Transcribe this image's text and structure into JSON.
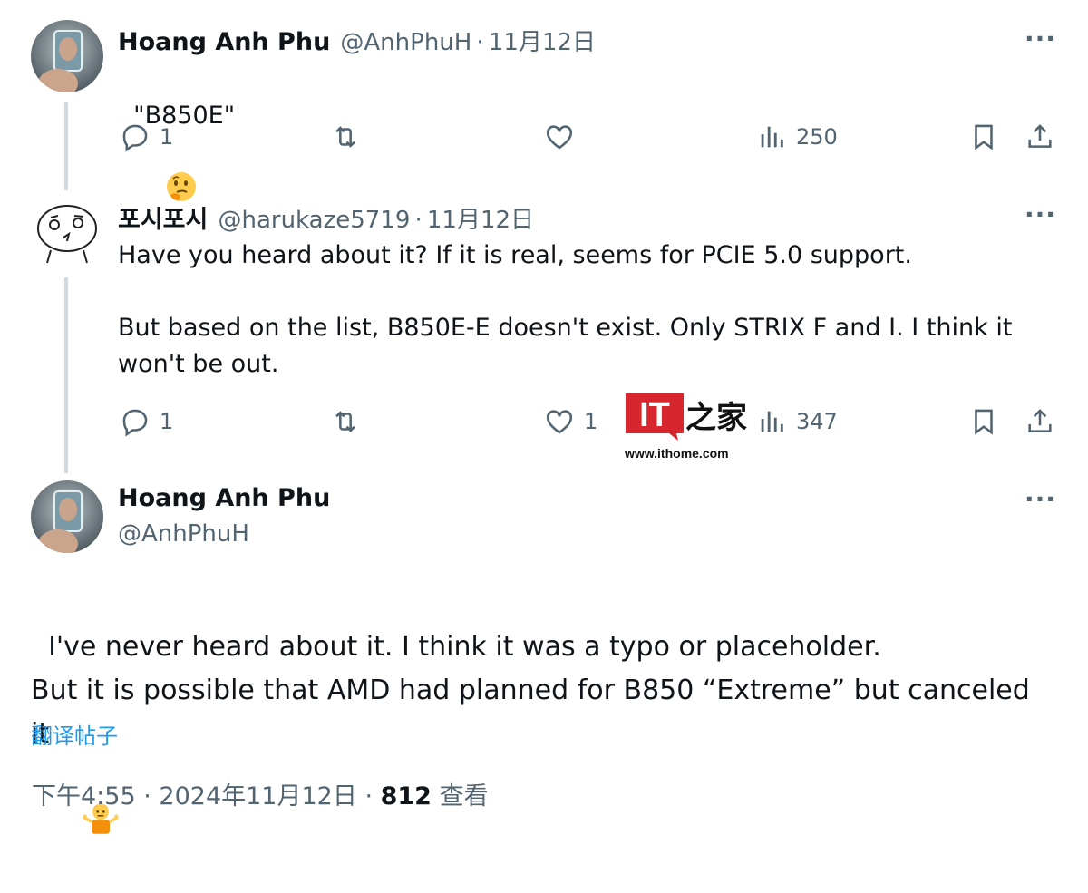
{
  "tweet1": {
    "name": "Hoang Anh Phu",
    "handle": "@AnhPhuH",
    "date": "11月12日",
    "text": "\"B850E\"",
    "emoji": "thinking-face",
    "more": "···",
    "actions": {
      "reply": "1",
      "retweet": "",
      "like": "",
      "views": "250"
    }
  },
  "tweet2": {
    "name": "포시포시",
    "handle": "@harukaze5719",
    "date": "11月12日",
    "text": "Have you heard about it? If it is real, seems for PCIE 5.0 support.\n\nBut based on the list, B850E-E doesn't exist. Only STRIX F and I. I think it won't be out.",
    "more": "···",
    "actions": {
      "reply": "1",
      "retweet": "",
      "like": "1",
      "views": "347"
    }
  },
  "watermark": {
    "logo": "IT之家",
    "url": "www.ithome.com"
  },
  "main_tweet": {
    "name": "Hoang Anh Phu",
    "handle": "@AnhPhuH",
    "more": "···",
    "text": "I've never heard about it. I think it was a typo or placeholder.\nBut it is possible that AMD had planned for B850 “Extreme” but canceled it",
    "emoji": "person-shrugging",
    "translate": "翻译帖子",
    "time": "下午4:55",
    "date": "2024年11月12日",
    "views_count": "812",
    "views_label": "查看"
  },
  "colors": {
    "secondary": "#536471",
    "link": "#1d9bf0",
    "thread": "#cfd9de",
    "brand_red": "#d8262e"
  }
}
